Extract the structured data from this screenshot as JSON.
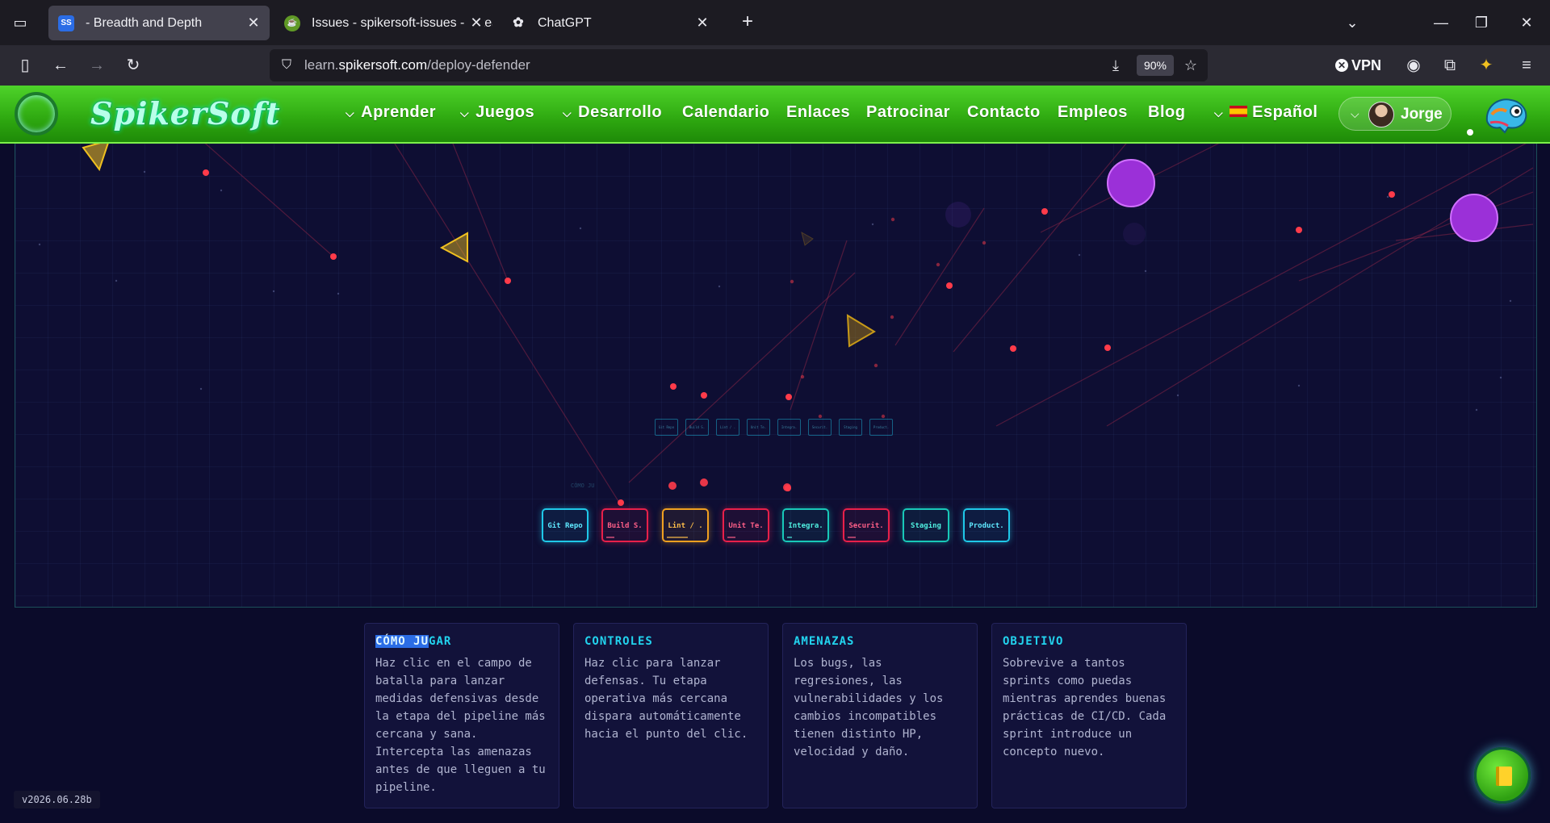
{
  "browser": {
    "tabs": [
      {
        "title": "- Breadth and Depth",
        "active": true,
        "favicon": "SS"
      },
      {
        "title": "Issues - spikersoft-issues - Gitea",
        "active": false,
        "favicon": "gitea"
      },
      {
        "title": "ChatGPT",
        "active": false,
        "favicon": "openai"
      }
    ],
    "url_prefix": "learn.",
    "url_host": "spikersoft.com",
    "url_path": "/deploy-defender",
    "zoom": "90%",
    "vpn_label": "VPN",
    "icons": [
      "tab-list-icon",
      "sidebar-icon",
      "back-icon",
      "forward-icon",
      "reload-icon",
      "shield-icon",
      "download-icon",
      "star-icon",
      "account-icon",
      "extensions-icon",
      "menu-icon",
      "minimize-icon",
      "restore-icon",
      "close-icon",
      "chevron-down-icon",
      "plus-icon"
    ]
  },
  "site": {
    "logo": "SpikerSoft",
    "menu": [
      {
        "label": "Aprender",
        "dropdown": true
      },
      {
        "label": "Juegos",
        "dropdown": true
      },
      {
        "label": "Desarrollo",
        "dropdown": true
      },
      {
        "label": "Calendario",
        "dropdown": false
      },
      {
        "label": "Enlaces",
        "dropdown": false
      },
      {
        "label": "Patrocinar",
        "dropdown": false
      },
      {
        "label": "Contacto",
        "dropdown": false
      },
      {
        "label": "Empleos",
        "dropdown": false
      },
      {
        "label": "Blog",
        "dropdown": false
      }
    ],
    "language": "Español",
    "user": "Jorge",
    "colors": {
      "header_green": "#2ea810",
      "neon_cyan": "#22d3ee",
      "threat_red": "#ff3b4a",
      "defense_yellow": "#f0c020",
      "boss_purple": "#a83ee0"
    }
  },
  "game": {
    "stages": [
      {
        "label": "Git Repo",
        "color": "cyan"
      },
      {
        "label": "Build S.",
        "color": "red"
      },
      {
        "label": "Lint / .",
        "color": "orange"
      },
      {
        "label": "Unit Te.",
        "color": "red"
      },
      {
        "label": "Integra.",
        "color": "teal"
      },
      {
        "label": "Securit.",
        "color": "red"
      },
      {
        "label": "Staging",
        "color": "teal"
      },
      {
        "label": "Product.",
        "color": "cyan"
      }
    ],
    "mini_stages": [
      "Git Repo",
      "Build S.",
      "Lint / .",
      "Unit Te.",
      "Integra.",
      "Securit.",
      "Staging",
      "Product."
    ],
    "ghost_label": "CÓMO JU"
  },
  "cards": [
    {
      "title_hl": "CÓMO JU",
      "title_rest": "GAR",
      "body": "Haz clic en el campo de batalla para lanzar medidas defensivas desde la etapa del pipeline más cercana y sana. Intercepta las amenazas antes de que lleguen a tu pipeline."
    },
    {
      "title_hl": "",
      "title_rest": "CONTROLES",
      "body": "Haz clic para lanzar defensas. Tu etapa operativa más cercana dispara automáticamente hacia el punto del clic."
    },
    {
      "title_hl": "",
      "title_rest": "AMENAZAS",
      "body": "Los bugs, las regresiones, las vulnerabilidades y los cambios incompatibles tienen distinto HP, velocidad y daño."
    },
    {
      "title_hl": "",
      "title_rest": "OBJETIVO",
      "body": "Sobrevive a tantos sprints como puedas mientras aprendes buenas prácticas de CI/CD. Cada sprint introduce un concepto nuevo."
    }
  ],
  "version": "v2026.06.28b"
}
